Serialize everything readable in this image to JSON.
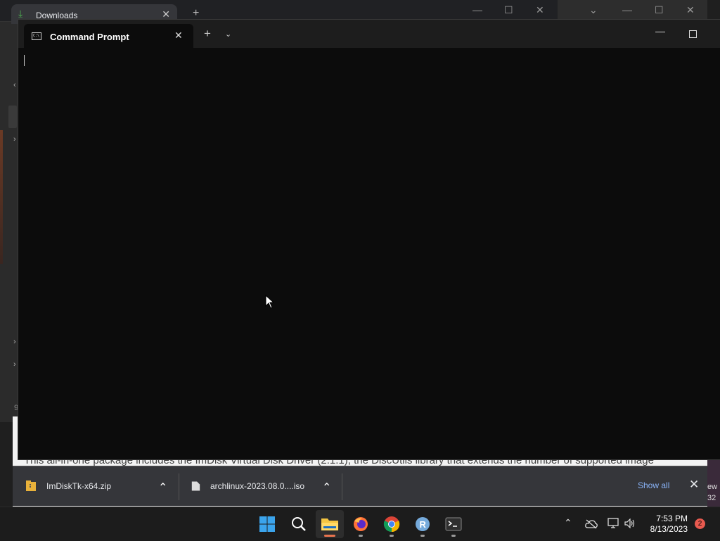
{
  "background_browser": {
    "tab_title": "Downloads",
    "page_text": "This all-in-one package includes the ImDisk Virtual Disk Driver (2.1.1), the DiscUtils library that extends the number of supported image",
    "edge_text_1": "ew",
    "edge_text_2": "32",
    "left_number": "9"
  },
  "downloads": {
    "items": [
      {
        "filename": "ImDiskTk-x64.zip",
        "icon": "zip-file-icon"
      },
      {
        "filename": "archlinux-2023.08.0....iso",
        "icon": "file-icon"
      }
    ],
    "show_all": "Show all"
  },
  "terminal": {
    "tab_title": "Command Prompt",
    "icon": "cmd-icon"
  },
  "taskbar": {
    "apps": [
      "start",
      "search",
      "file-explorer",
      "firefox",
      "chrome",
      "r-studio",
      "terminal"
    ],
    "clock_time": "7:53 PM",
    "clock_date": "8/13/2023",
    "notification_count": "2"
  },
  "colors": {
    "terminal_bg": "#0c0c0c",
    "accent_blue": "#8ab4f8",
    "notification_badge": "#e85a4f",
    "windows_blue": "#0078d4"
  }
}
